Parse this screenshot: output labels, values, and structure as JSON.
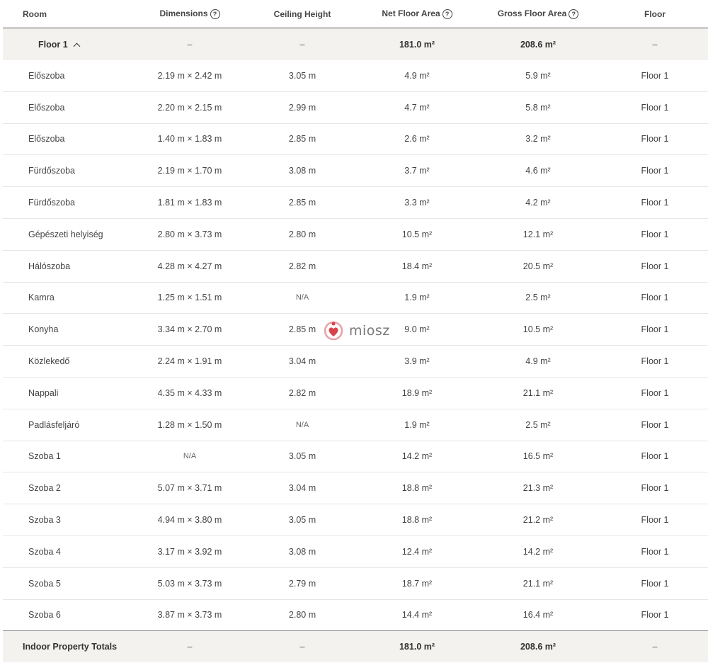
{
  "columns": {
    "room": "Room",
    "dimensions": "Dimensions",
    "ceiling_height": "Ceiling Height",
    "net_floor_area": "Net Floor Area",
    "gross_floor_area": "Gross Floor Area",
    "floor": "Floor",
    "help_icon_glyph": "?"
  },
  "floor_group": {
    "label": "Floor 1",
    "dimensions": "–",
    "ceiling_height": "–",
    "net_floor_area": "181.0 m²",
    "gross_floor_area": "208.6 m²",
    "floor": "–",
    "expanded": true
  },
  "rows": [
    {
      "room": "Előszoba",
      "dimensions": "2.19 m × 2.42 m",
      "ceiling": "3.05 m",
      "net": "4.9 m²",
      "gross": "5.9 m²",
      "floor": "Floor 1"
    },
    {
      "room": "Előszoba",
      "dimensions": "2.20 m × 2.15 m",
      "ceiling": "2.99 m",
      "net": "4.7 m²",
      "gross": "5.8 m²",
      "floor": "Floor 1"
    },
    {
      "room": "Előszoba",
      "dimensions": "1.40 m × 1.83 m",
      "ceiling": "2.85 m",
      "net": "2.6 m²",
      "gross": "3.2 m²",
      "floor": "Floor 1"
    },
    {
      "room": "Fürdőszoba",
      "dimensions": "2.19 m × 1.70 m",
      "ceiling": "3.08 m",
      "net": "3.7 m²",
      "gross": "4.6 m²",
      "floor": "Floor 1"
    },
    {
      "room": "Fürdőszoba",
      "dimensions": "1.81 m × 1.83 m",
      "ceiling": "2.85 m",
      "net": "3.3 m²",
      "gross": "4.2 m²",
      "floor": "Floor 1"
    },
    {
      "room": "Gépészeti helyiség",
      "dimensions": "2.80 m × 3.73 m",
      "ceiling": "2.80 m",
      "net": "10.5 m²",
      "gross": "12.1 m²",
      "floor": "Floor 1"
    },
    {
      "room": "Hálószoba",
      "dimensions": "4.28 m × 4.27 m",
      "ceiling": "2.82 m",
      "net": "18.4 m²",
      "gross": "20.5 m²",
      "floor": "Floor 1"
    },
    {
      "room": "Kamra",
      "dimensions": "1.25 m × 1.51 m",
      "ceiling": "N/A",
      "net": "1.9 m²",
      "gross": "2.5 m²",
      "floor": "Floor 1"
    },
    {
      "room": "Konyha",
      "dimensions": "3.34 m × 2.70 m",
      "ceiling": "2.85 m",
      "net": "9.0 m²",
      "gross": "10.5 m²",
      "floor": "Floor 1"
    },
    {
      "room": "Közlekedő",
      "dimensions": "2.24 m × 1.91 m",
      "ceiling": "3.04 m",
      "net": "3.9 m²",
      "gross": "4.9 m²",
      "floor": "Floor 1"
    },
    {
      "room": "Nappali",
      "dimensions": "4.35 m × 4.33 m",
      "ceiling": "2.82 m",
      "net": "18.9 m²",
      "gross": "21.1 m²",
      "floor": "Floor 1"
    },
    {
      "room": "Padlásfeljáró",
      "dimensions": "1.28 m × 1.50 m",
      "ceiling": "N/A",
      "net": "1.9 m²",
      "gross": "2.5 m²",
      "floor": "Floor 1"
    },
    {
      "room": "Szoba 1",
      "dimensions": "N/A",
      "ceiling": "3.05 m",
      "net": "14.2 m²",
      "gross": "16.5 m²",
      "floor": "Floor 1"
    },
    {
      "room": "Szoba 2",
      "dimensions": "5.07 m × 3.71 m",
      "ceiling": "3.04 m",
      "net": "18.8 m²",
      "gross": "21.3 m²",
      "floor": "Floor 1"
    },
    {
      "room": "Szoba 3",
      "dimensions": "4.94 m × 3.80 m",
      "ceiling": "3.05 m",
      "net": "18.8 m²",
      "gross": "21.2 m²",
      "floor": "Floor 1"
    },
    {
      "room": "Szoba 4",
      "dimensions": "3.17 m × 3.92 m",
      "ceiling": "3.08 m",
      "net": "12.4 m²",
      "gross": "14.2 m²",
      "floor": "Floor 1"
    },
    {
      "room": "Szoba 5",
      "dimensions": "5.03 m × 3.73 m",
      "ceiling": "2.79 m",
      "net": "18.7 m²",
      "gross": "21.1 m²",
      "floor": "Floor 1"
    },
    {
      "room": "Szoba 6",
      "dimensions": "3.87 m × 3.73 m",
      "ceiling": "2.80 m",
      "net": "14.4 m²",
      "gross": "16.4 m²",
      "floor": "Floor 1"
    }
  ],
  "totals": {
    "label": "Indoor Property Totals",
    "dimensions": "–",
    "ceiling_height": "–",
    "net_floor_area": "181.0 m²",
    "gross_floor_area": "208.6 m²",
    "floor": "–"
  },
  "watermark": {
    "text": "miosz",
    "colors": {
      "pink": "#e8a0a8",
      "red": "#d9424a"
    }
  }
}
